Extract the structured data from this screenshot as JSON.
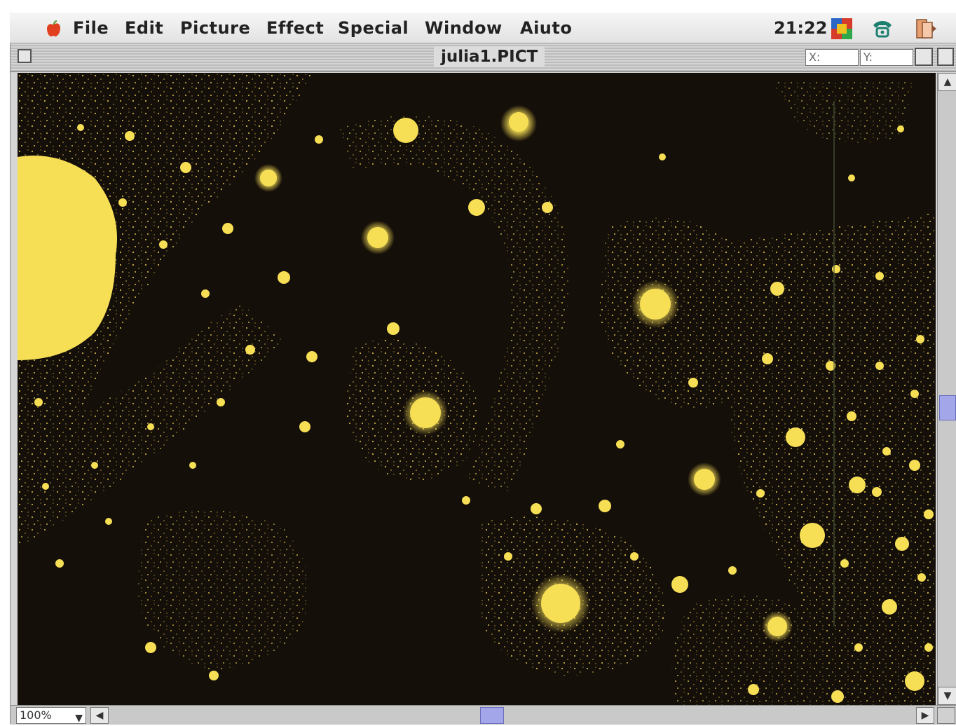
{
  "menubar": {
    "apple_icon": "apple-logo-icon",
    "items": [
      "File",
      "Edit",
      "Picture",
      "Effect",
      "Special",
      "Window",
      "Aiuto"
    ],
    "clock": "21:22",
    "status_icons": [
      "color-picker-icon",
      "phone-icon",
      "application-switcher-icon"
    ]
  },
  "window": {
    "title": "julia1.PICT",
    "x_label": "X:",
    "y_label": "Y:",
    "zoom": "100%"
  },
  "colors": {
    "fractal_background": "#150f09",
    "fractal_highlight": "#f7df55",
    "scroll_thumb": "#a3a6e8"
  }
}
